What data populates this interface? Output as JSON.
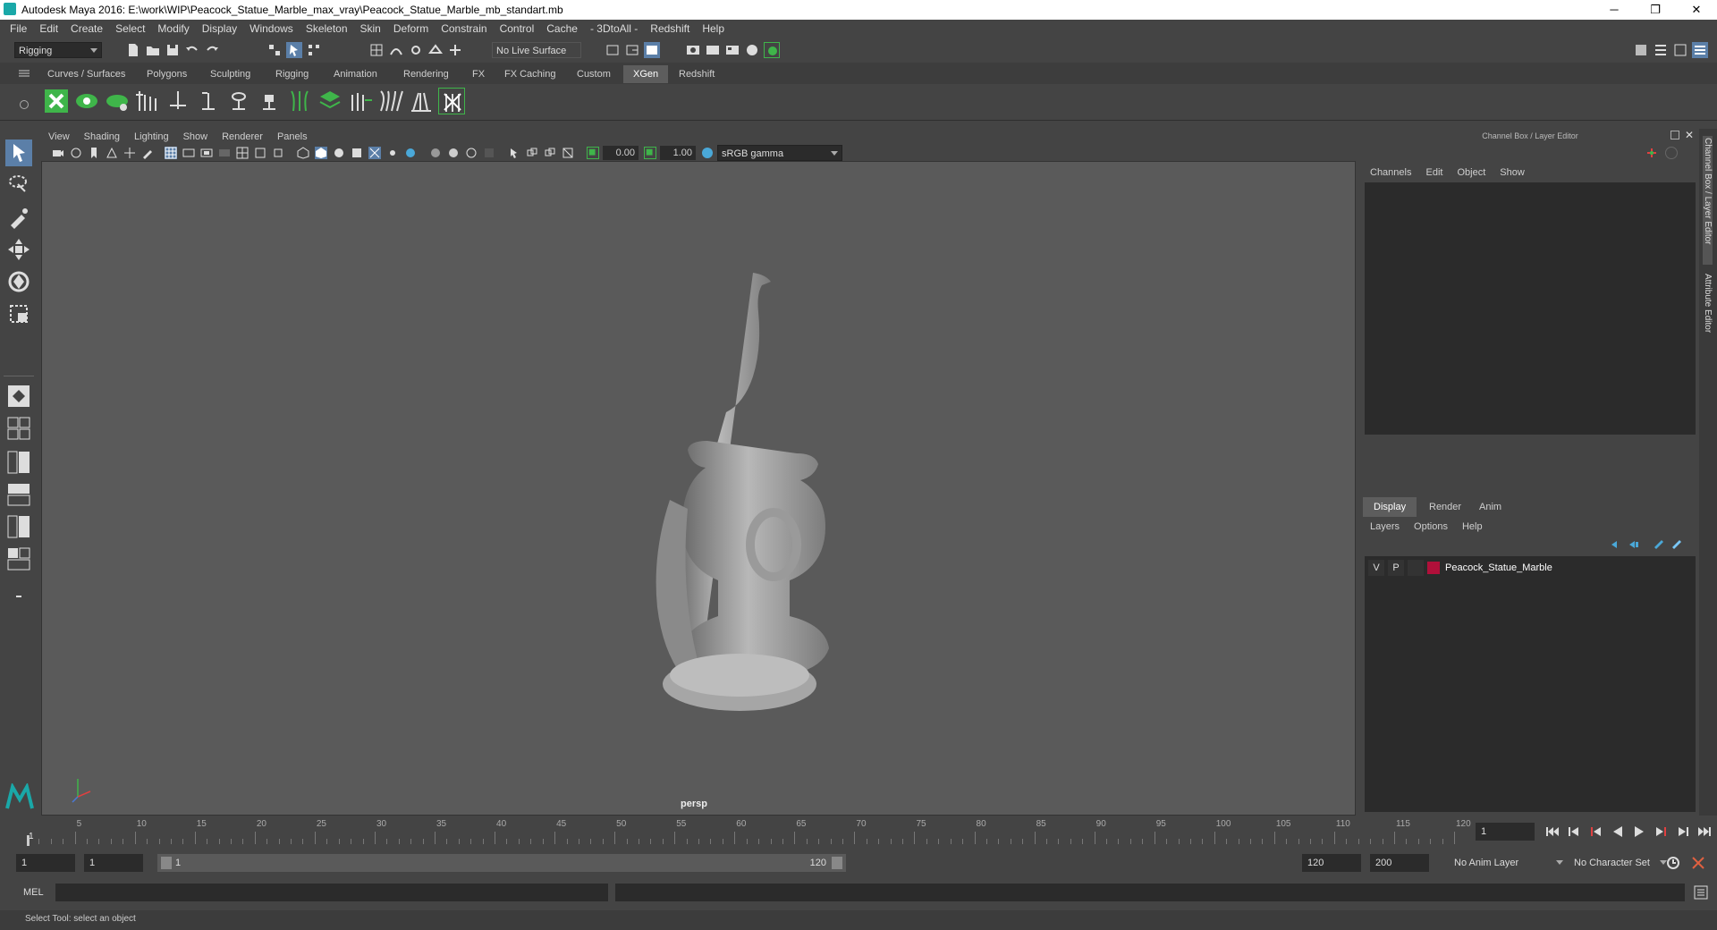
{
  "window": {
    "title": "Autodesk Maya 2016: E:\\work\\WIP\\Peacock_Statue_Marble_max_vray\\Peacock_Statue_Marble_mb_standart.mb",
    "minimize": "─",
    "restore": "❐",
    "close": "✕"
  },
  "menubar": [
    "File",
    "Edit",
    "Create",
    "Select",
    "Modify",
    "Display",
    "Windows",
    "Skeleton",
    "Skin",
    "Deform",
    "Constrain",
    "Control",
    "Cache",
    "- 3DtoAll -",
    "Redshift",
    "Help"
  ],
  "statusline": {
    "menuset": "Rigging",
    "live_surface": "No Live Surface"
  },
  "shelf_tabs": [
    "Curves / Surfaces",
    "Polygons",
    "Sculpting",
    "Rigging",
    "Animation",
    "Rendering",
    "FX",
    "FX Caching",
    "Custom",
    "XGen",
    "Redshift"
  ],
  "shelf_active_tab": "XGen",
  "viewport": {
    "menu": [
      "View",
      "Shading",
      "Lighting",
      "Show",
      "Renderer",
      "Panels"
    ],
    "exposure": "0.00",
    "gamma": "1.00",
    "color_space": "sRGB gamma",
    "camera": "persp"
  },
  "right_panel": {
    "header": "Channel Box / Layer Editor",
    "channel_menu": [
      "Channels",
      "Edit",
      "Object",
      "Show"
    ],
    "layer_tabs": [
      "Display",
      "Render",
      "Anim"
    ],
    "layer_active_tab": "Display",
    "layer_menu": [
      "Layers",
      "Options",
      "Help"
    ],
    "layers": [
      {
        "visible": "V",
        "playback": "P",
        "color": "#b0103a",
        "name": "Peacock_Statue_Marble"
      }
    ],
    "side_tabs": [
      "Channel Box / Layer Editor",
      "Attribute Editor"
    ]
  },
  "timeline": {
    "ticks": [
      1,
      5,
      10,
      15,
      20,
      25,
      30,
      35,
      40,
      45,
      50,
      55,
      60,
      65,
      70,
      75,
      80,
      85,
      90,
      95,
      100,
      105,
      110,
      115,
      120
    ],
    "current_frame": "1",
    "range_start": "1",
    "range_inner_start": "1",
    "slider_start": "1",
    "slider_end": "120",
    "range_inner_end": "120",
    "range_end": "200",
    "anim_layer": "No Anim Layer",
    "character_set": "No Character Set"
  },
  "command_line": {
    "label": "MEL"
  },
  "help_line": "Select Tool: select an object",
  "colors": {
    "accent": "#5d5d5d",
    "shelf_green": "#3fb54a",
    "viewport_bg": "#5a5a5a",
    "layer_color": "#b0103a"
  }
}
